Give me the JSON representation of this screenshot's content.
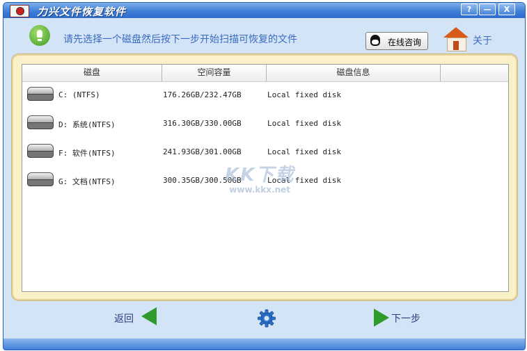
{
  "window": {
    "title": "力兴文件恢复软件"
  },
  "title_controls": [
    "?",
    "—",
    "X"
  ],
  "tip": {
    "text": "请先选择一个磁盘然后按下一步开始扫描可恢复的文件"
  },
  "consult": {
    "label": "在线咨询"
  },
  "about": {
    "label": "关于"
  },
  "table": {
    "headers": [
      "磁盘",
      "空间容量",
      "磁盘信息",
      ""
    ],
    "rows": [
      {
        "disk": "C: (NTFS)",
        "capacity": "176.26GB/232.47GB",
        "info": "Local fixed disk"
      },
      {
        "disk": "D: 系统(NTFS)",
        "capacity": "316.30GB/330.00GB",
        "info": "Local fixed disk"
      },
      {
        "disk": "F: 软件(NTFS)",
        "capacity": "241.93GB/301.00GB",
        "info": "Local fixed disk"
      },
      {
        "disk": "G: 文档(NTFS)",
        "capacity": "300.35GB/300.50GB",
        "info": "Local fixed disk"
      }
    ]
  },
  "watermark": {
    "main": "KK下载",
    "sub": "www.kkx.net"
  },
  "footer": {
    "back_label": "返回",
    "next_label": "下一步"
  },
  "colors": {
    "accent": "#3f7fd8",
    "arrow": "#2f9b2a",
    "frame": "#fbf1c9"
  },
  "icons": [
    "app-icon",
    "bulb-icon",
    "qq-icon",
    "home-icon",
    "disk-icon",
    "back-arrow-icon",
    "gear-icon",
    "next-arrow-icon"
  ]
}
